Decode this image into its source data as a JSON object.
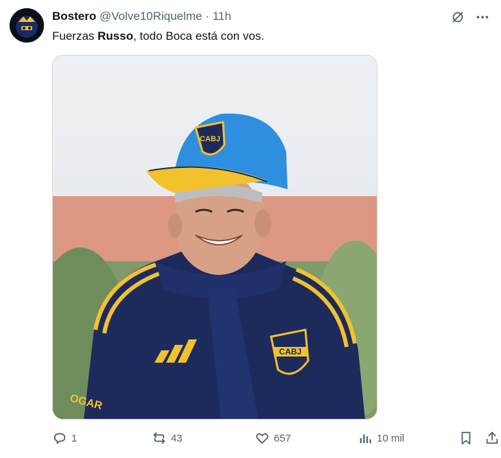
{
  "tweet": {
    "author_name": "Bostero",
    "handle": "@Volve10Riquelme",
    "separator": "·",
    "time": "11h",
    "text_before": "Fuerzas ",
    "text_bold": "Russo",
    "text_after": ", todo Boca está con vos."
  },
  "media": {
    "cap_badge": "CABJ",
    "shirt_badge": "CABJ",
    "sleeve_text": "OGAR"
  },
  "actions": {
    "replies": "1",
    "reposts": "43",
    "likes": "657",
    "views": "10 mil"
  },
  "icons": {
    "more": "more-icon",
    "grok": "grok-icon",
    "reply": "reply-icon",
    "repost": "repost-icon",
    "like": "heart-icon",
    "views": "views-icon",
    "bookmark": "bookmark-icon",
    "share": "share-icon"
  },
  "colors": {
    "boca_blue": "#1c2a5c",
    "boca_gold": "#f2c12e",
    "cap_blue": "#2e8fe0",
    "muted": "#536471"
  }
}
